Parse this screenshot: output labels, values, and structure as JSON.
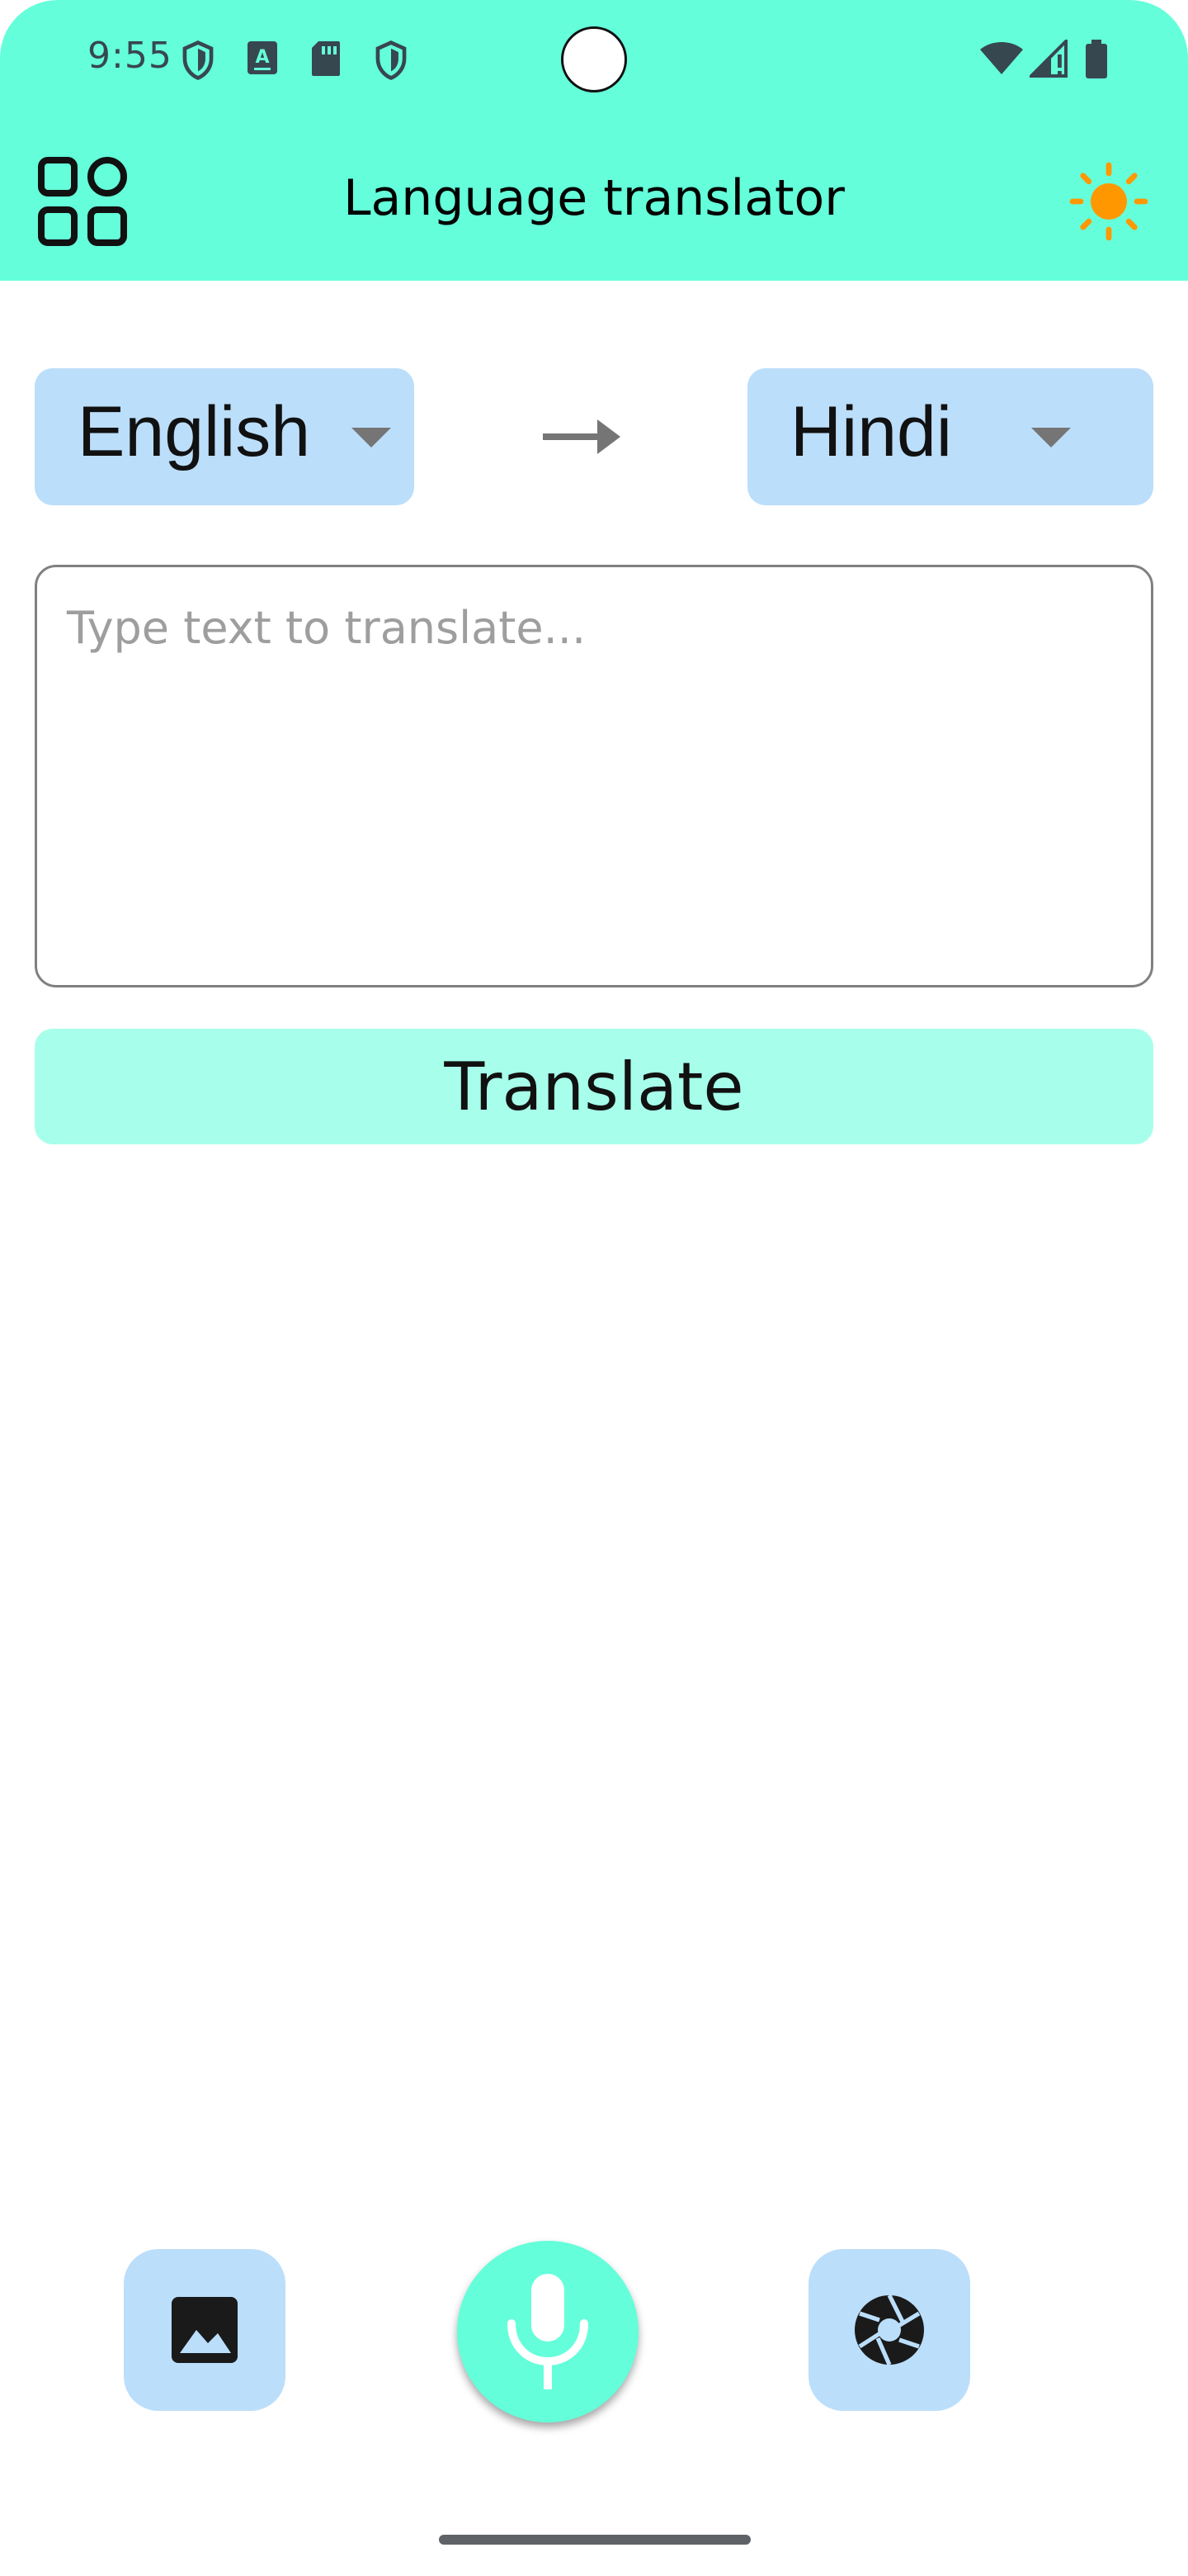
{
  "status_bar": {
    "time": "9:55",
    "left_icons": [
      "shield-icon",
      "keyboard-a-icon",
      "sd-card-icon",
      "shield-icon"
    ],
    "right_icons": [
      "wifi-icon",
      "cellular-signal-icon",
      "battery-icon"
    ]
  },
  "app_bar": {
    "title": "Language translator",
    "menu_icon": "grid-apps-icon",
    "theme_icon": "sun-icon"
  },
  "languages": {
    "source": "English",
    "target": "Hindi",
    "swap_icon": "arrow-right-icon"
  },
  "input": {
    "placeholder": "Type text to translate...",
    "value": ""
  },
  "translate_button": {
    "label": "Translate"
  },
  "bottom_actions": {
    "image": "image-icon",
    "mic": "microphone-icon",
    "camera": "camera-shutter-icon"
  },
  "colors": {
    "accent": "#64ffda",
    "accent_light": "#a7ffeb",
    "chip_blue": "#bbdefb",
    "sun_orange": "#ff9800"
  }
}
